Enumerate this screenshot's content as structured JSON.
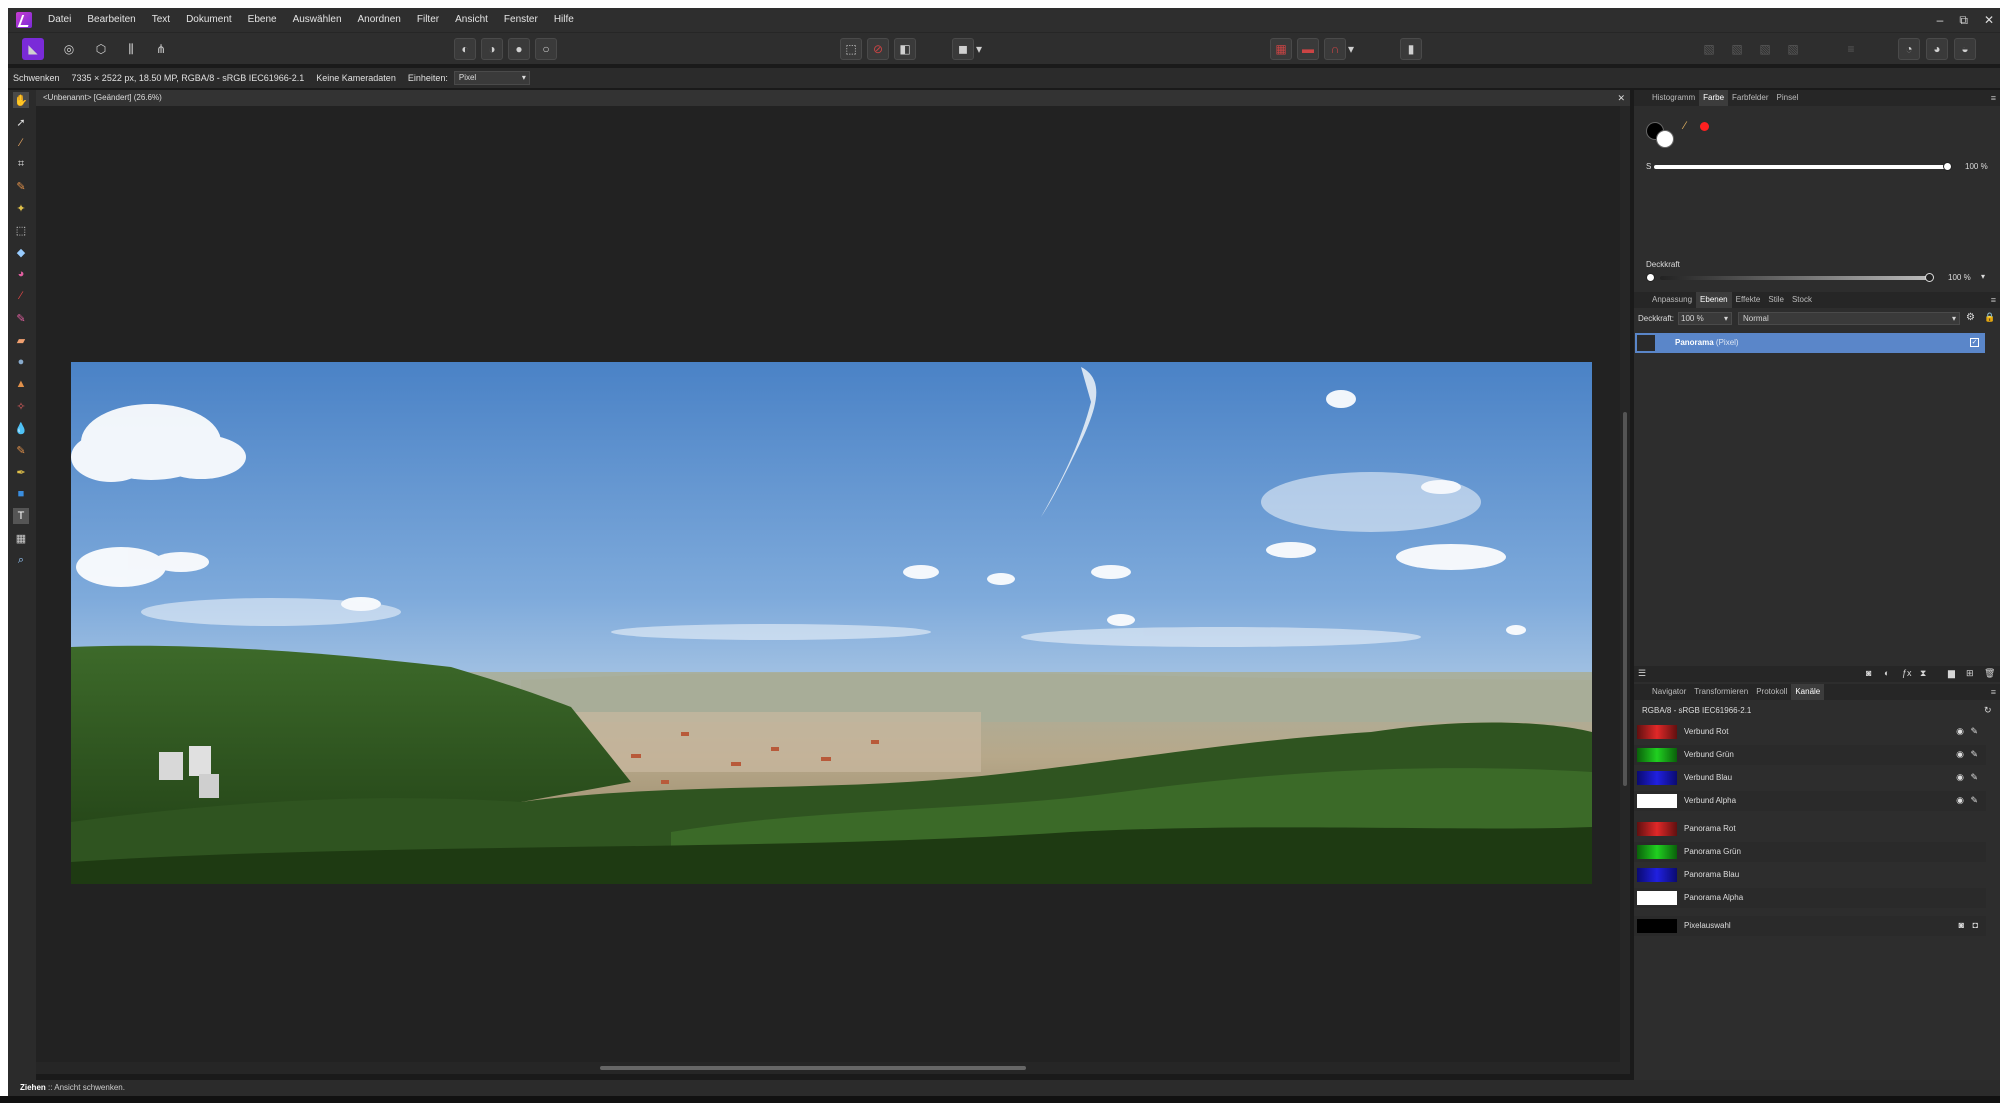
{
  "menu": {
    "items": [
      "Datei",
      "Bearbeiten",
      "Text",
      "Dokument",
      "Ebene",
      "Auswählen",
      "Anordnen",
      "Filter",
      "Ansicht",
      "Fenster",
      "Hilfe"
    ]
  },
  "window": {
    "minimize": "–",
    "maximize": "⧉",
    "close": "✕"
  },
  "context": {
    "tool_name": "Schwenken",
    "doc_info": "7335 × 2522 px, 18.50 MP, RGBA/8 - sRGB IEC61966-2.1",
    "camera": "Keine Kameradaten",
    "units_label": "Einheiten:",
    "units_value": "Pixel"
  },
  "document": {
    "tab_title": "<Unbenannt> [Geändert] (26.6%)"
  },
  "color_panel": {
    "tabs": [
      "Histogramm",
      "Farbe",
      "Farbfelder",
      "Pinsel"
    ],
    "active_tab": "Farbe",
    "s_label": "S",
    "s_value": "100 %",
    "s_level": 1.0,
    "opacity_label": "Deckkraft",
    "opacity_value": "100 %",
    "opacity_level": 1.0,
    "accent": "#ff2020"
  },
  "layers_panel": {
    "tabs": [
      "Anpassung",
      "Ebenen",
      "Effekte",
      "Stile",
      "Stock"
    ],
    "active_tab": "Ebenen",
    "opacity_label": "Deckkraft:",
    "opacity_value": "100 %",
    "blend_mode": "Normal",
    "layer_name": "Panorama",
    "layer_type": "(Pixel)",
    "selection_color": "#5a86c9"
  },
  "channels_panel": {
    "tabs": [
      "Navigator",
      "Transformieren",
      "Protokoll",
      "Kanäle"
    ],
    "active_tab": "Kanäle",
    "header": "RGBA/8 - sRGB IEC61966-2.1",
    "composite": [
      {
        "label": "Verbund Rot",
        "color": "#c41a1a"
      },
      {
        "label": "Verbund Grün",
        "color": "#18c418"
      },
      {
        "label": "Verbund Blau",
        "color": "#1a1ad8"
      },
      {
        "label": "Verbund Alpha",
        "color": "#ffffff"
      }
    ],
    "layer": [
      {
        "label": "Panorama Rot",
        "color": "#c41a1a"
      },
      {
        "label": "Panorama Grün",
        "color": "#18c418"
      },
      {
        "label": "Panorama Blau",
        "color": "#1a1ad8"
      },
      {
        "label": "Panorama Alpha",
        "color": "#ffffff"
      }
    ],
    "selection": {
      "label": "Pixelauswahl",
      "color": "#000000"
    }
  },
  "status": {
    "action": "Ziehen",
    "hint": ":: Ansicht schwenken."
  }
}
